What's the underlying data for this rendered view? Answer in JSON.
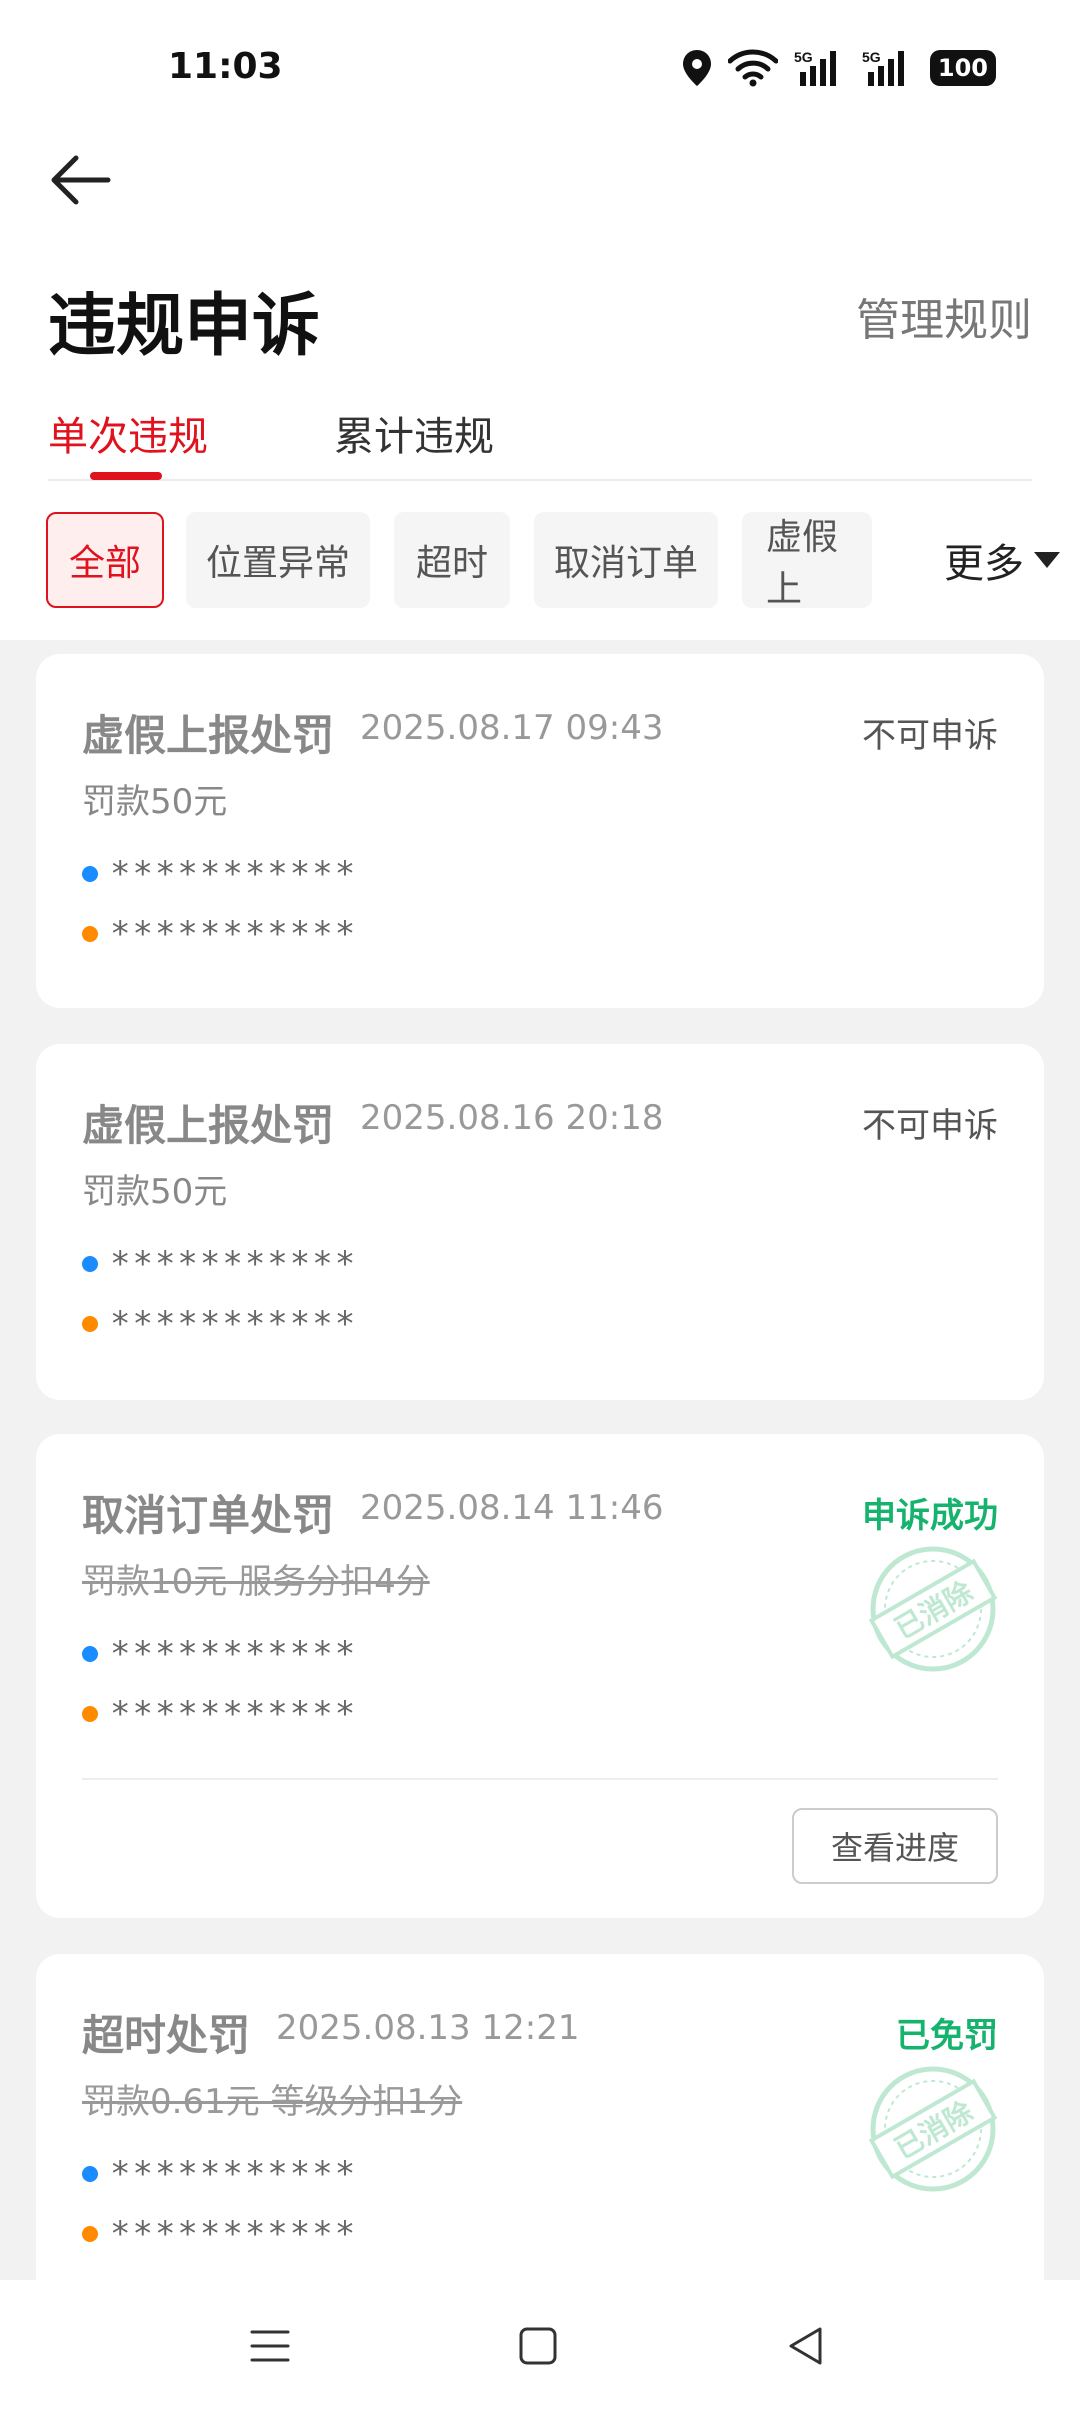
{
  "status_bar": {
    "time": "11:03",
    "network_1": "5G",
    "network_2": "5G",
    "battery": "100",
    "icons": [
      "location-icon",
      "wifi-icon",
      "signal-5g-icon",
      "signal-5g-icon",
      "battery-icon"
    ]
  },
  "header": {
    "back_icon": "arrow-left-icon",
    "title": "违规申诉",
    "manage_rules": "管理规则"
  },
  "tabs": [
    {
      "label": "单次违规",
      "active": true
    },
    {
      "label": "累计违规",
      "active": false
    }
  ],
  "filters": {
    "chips": [
      {
        "label": "全部",
        "active": true
      },
      {
        "label": "位置异常",
        "active": false
      },
      {
        "label": "超时",
        "active": false
      },
      {
        "label": "取消订单",
        "active": false
      },
      {
        "label": "虚假上",
        "active": false
      }
    ],
    "more_label": "更多"
  },
  "cards": [
    {
      "title": "虚假上报处罚",
      "time": "2025.08.17 09:43",
      "status": "不可申诉",
      "fine": "罚款50元",
      "line_blue": "***********",
      "line_orange": "***********"
    },
    {
      "title": "虚假上报处罚",
      "time": "2025.08.16 20:18",
      "status": "不可申诉",
      "fine": "罚款50元",
      "line_blue": "***********",
      "line_orange": "***********"
    },
    {
      "title": "取消订单处罚",
      "time": "2025.08.14 11:46",
      "status": "申诉成功",
      "fine": "罚款10元 服务分扣4分",
      "line_blue": "***********",
      "line_orange": "***********",
      "stamp": "已消除",
      "button": "查看进度"
    },
    {
      "title": "超时处罚",
      "time": "2025.08.13 12:21",
      "status": "已免罚",
      "fine": "罚款0.61元 等级分扣1分",
      "line_blue": "***********",
      "line_orange": "***********",
      "stamp": "已消除"
    }
  ],
  "nav_bar": {
    "icons": [
      "menu-icon",
      "home-square-icon",
      "back-triangle-icon"
    ]
  },
  "colors": {
    "accent": "#e0121d",
    "success": "#16b36e",
    "dot_blue": "#1a8cff",
    "dot_orange": "#ff8a00"
  }
}
